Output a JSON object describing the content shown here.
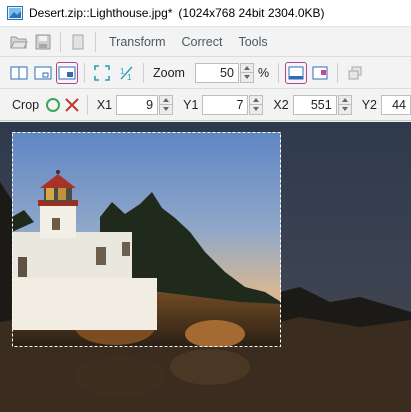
{
  "window": {
    "title": "Desert.zip::Lighthouse.jpg*",
    "info": "(1024x768  24bit  2304.0KB)"
  },
  "menu": {
    "items": [
      "Transform",
      "Correct",
      "Tools"
    ]
  },
  "view": {
    "zoom_label": "Zoom",
    "zoom_value": "50",
    "zoom_unit": "%"
  },
  "crop": {
    "label": "Crop",
    "x1_label": "X1",
    "x1_value": "9",
    "y1_label": "Y1",
    "y1_value": "7",
    "x2_label": "X2",
    "x2_value": "551",
    "y2_label": "Y2",
    "y2_value": "44"
  },
  "colors": {
    "accent": "#a24a8d",
    "confirm": "#3aa655",
    "cancel": "#c0392b",
    "link_text": "#4a5a66"
  }
}
